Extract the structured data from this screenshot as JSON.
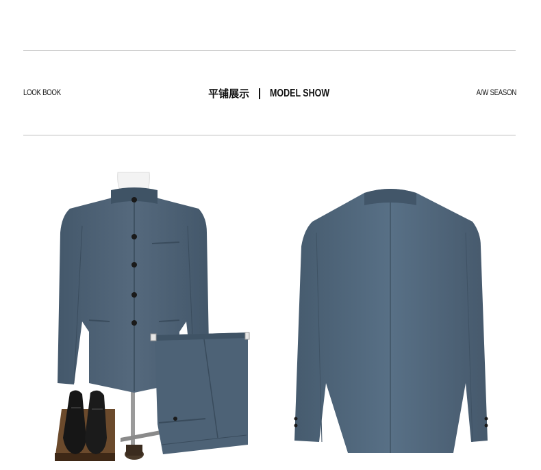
{
  "header": {
    "left_label": "LOOK BOOK",
    "center_cn": "平铺展示",
    "center_en": "MODEL SHOW",
    "right_label": "A/W SEASON"
  },
  "colors": {
    "suit": "#4f6579",
    "suit_dark": "#3c4f61",
    "shoe": "#151515",
    "wood": "#5a3a22",
    "rule": "#bdbdbd"
  }
}
